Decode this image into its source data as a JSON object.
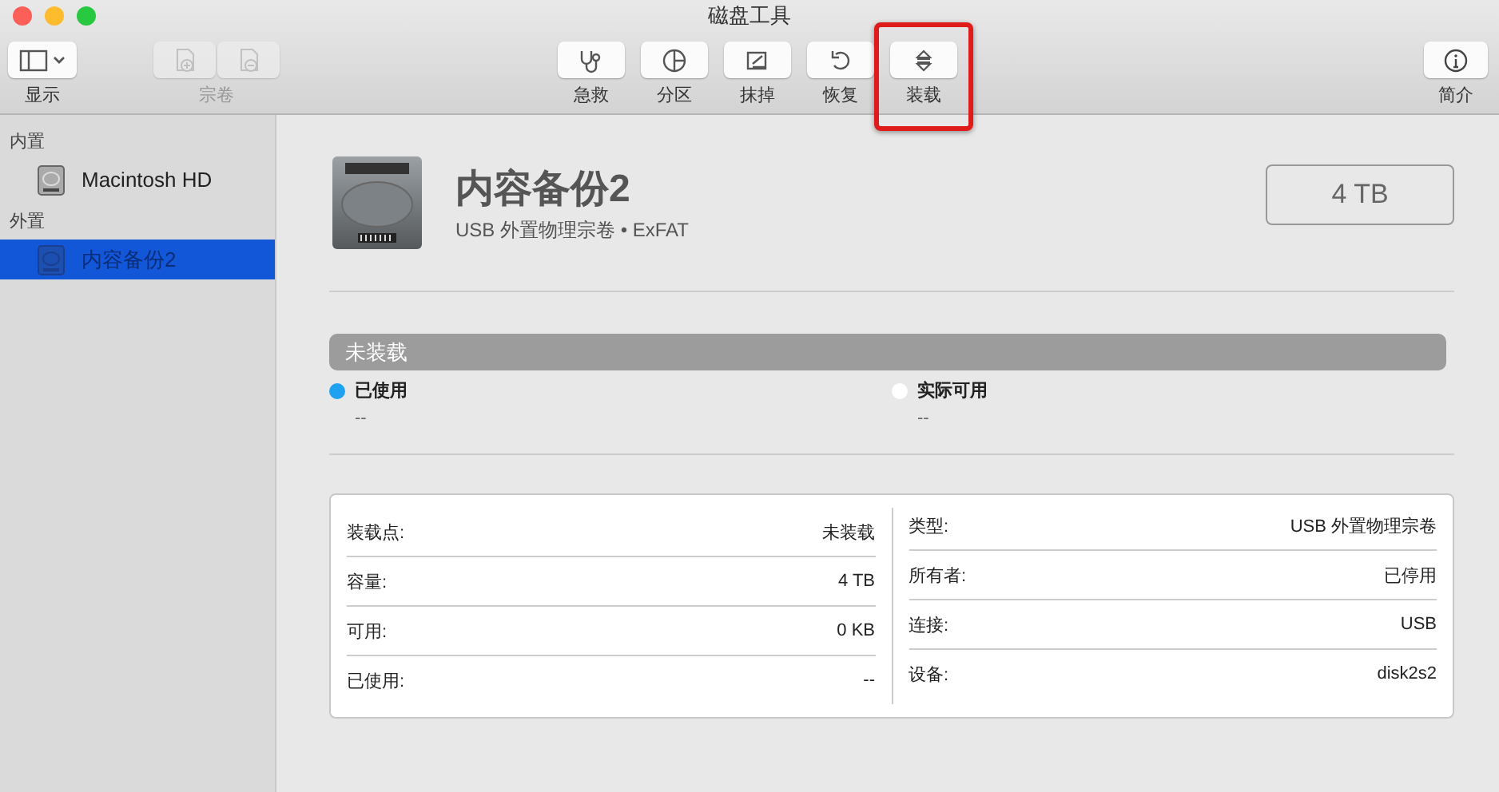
{
  "window": {
    "title": "磁盘工具"
  },
  "toolbar": {
    "left": [
      {
        "kind": "view",
        "label": "显示",
        "disabled": false
      },
      {
        "kind": "volume",
        "label": "宗卷",
        "disabled": true
      }
    ],
    "tools": [
      {
        "kind": "firstaid",
        "label": "急救",
        "highlighted": false
      },
      {
        "kind": "partition",
        "label": "分区",
        "highlighted": false
      },
      {
        "kind": "erase",
        "label": "抹掉",
        "highlighted": false
      },
      {
        "kind": "restore",
        "label": "恢复",
        "highlighted": false
      },
      {
        "kind": "mount",
        "label": "装载",
        "highlighted": true
      }
    ],
    "info": {
      "label": "简介"
    }
  },
  "sidebar": {
    "sections": [
      {
        "title": "内置",
        "items": [
          {
            "name": "Macintosh HD",
            "selected": false
          }
        ]
      },
      {
        "title": "外置",
        "items": [
          {
            "name": "内容备份2",
            "selected": true
          }
        ]
      }
    ]
  },
  "volume": {
    "name": "内容备份2",
    "subtitle": "USB 外置物理宗卷 • ExFAT",
    "size": "4 TB"
  },
  "usage": {
    "bar_label": "未装载",
    "legend": [
      {
        "label": "已使用",
        "value": "--",
        "color": "#1ea1f0"
      },
      {
        "label": "实际可用",
        "value": "--",
        "color": "#ffffff"
      }
    ]
  },
  "details": {
    "left": [
      {
        "label": "装载点:",
        "value": "未装载"
      },
      {
        "label": "容量:",
        "value": "4 TB"
      },
      {
        "label": "可用:",
        "value": "0 KB"
      },
      {
        "label": "已使用:",
        "value": "--"
      }
    ],
    "right": [
      {
        "label": "类型:",
        "value": "USB 外置物理宗卷"
      },
      {
        "label": "所有者:",
        "value": "已停用"
      },
      {
        "label": "连接:",
        "value": "USB"
      },
      {
        "label": "设备:",
        "value": "disk2s2"
      }
    ]
  }
}
